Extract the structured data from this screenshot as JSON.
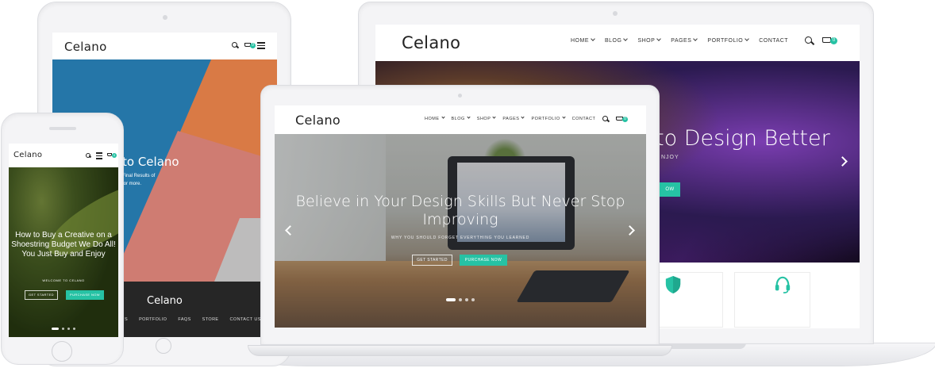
{
  "brand": "Celano",
  "accent_color": "#26c2a4",
  "cart_count": "0",
  "desktop": {
    "nav": [
      {
        "label": "HOME",
        "has_dropdown": true
      },
      {
        "label": "BLOG",
        "has_dropdown": true
      },
      {
        "label": "SHOP",
        "has_dropdown": true
      },
      {
        "label": "PAGES",
        "has_dropdown": true
      },
      {
        "label": "PORTFOLIO",
        "has_dropdown": true
      },
      {
        "label": "CONTACT",
        "has_dropdown": false
      }
    ],
    "hero_title": "to Design Better",
    "hero_subtitle": "NJOY",
    "hero_button": "OW",
    "icons": [
      "search-icon",
      "cart-icon",
      "shield-icon",
      "headset-icon",
      "chevron-right-icon"
    ]
  },
  "laptop": {
    "nav": [
      {
        "label": "HOME",
        "has_dropdown": true
      },
      {
        "label": "BLOG",
        "has_dropdown": true
      },
      {
        "label": "SHOP",
        "has_dropdown": true
      },
      {
        "label": "PAGES",
        "has_dropdown": true
      },
      {
        "label": "PORTFOLIO",
        "has_dropdown": true
      },
      {
        "label": "CONTACT",
        "has_dropdown": false
      }
    ],
    "hero_title": "Believe in Your Design Skills But Never Stop Improving",
    "hero_subtitle": "WHY YOU SHOULD FORGET EVERYTHING YOU LEARNED",
    "button_outline": "GET STARTED",
    "button_fill": "PURCHASE NOW",
    "slide_count": 4,
    "active_slide": 1
  },
  "tablet": {
    "hero_title": "to Celano",
    "hero_line1": "Final Results of",
    "hero_line2": "for more.",
    "footer_logo": "Celano",
    "footer_links": [
      "S",
      "PORTFOLIO",
      "FAQS",
      "STORE",
      "CONTACT US"
    ]
  },
  "phone": {
    "hero_title": "How to Buy a Creative on a Shoestring Budget We Do All! You Just Buy and Enjoy",
    "hero_subtitle": "WELCOME TO CELANO",
    "button_outline": "GET STARTED",
    "button_fill": "PURCHASE NOW",
    "slide_count": 4,
    "active_slide": 1
  }
}
